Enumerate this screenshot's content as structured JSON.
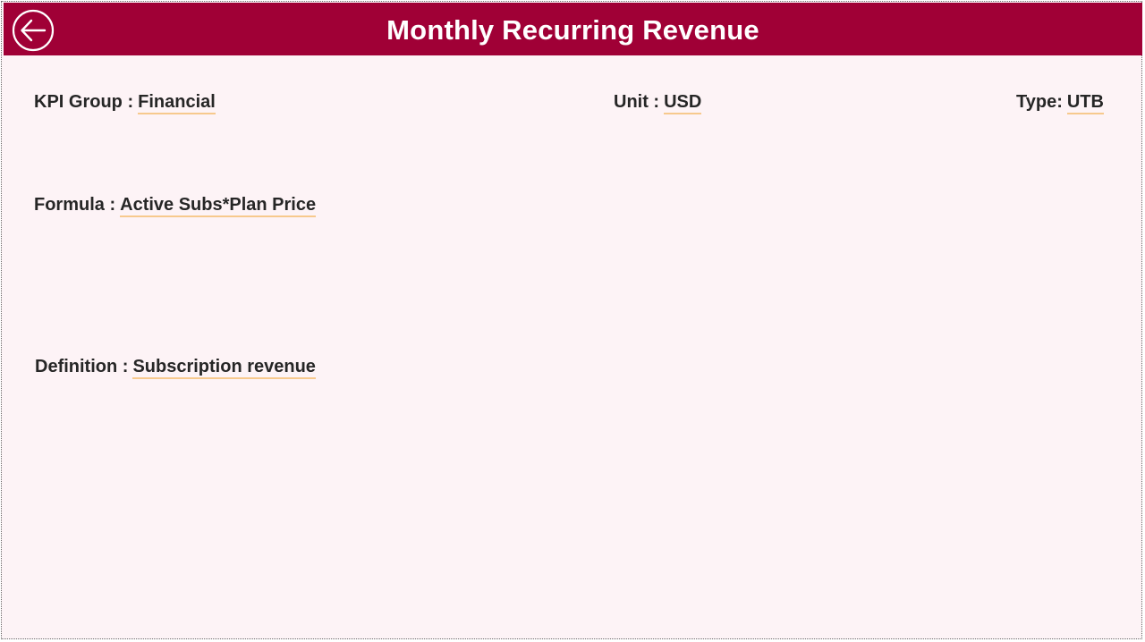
{
  "header": {
    "title": "Monthly Recurring Revenue",
    "back_icon": "back-arrow-circle-icon",
    "background_color": "#a00036"
  },
  "fields": {
    "kpi_group": {
      "label": "KPI Group :",
      "value": "Financial"
    },
    "unit": {
      "label": "Unit :",
      "value": "USD"
    },
    "type": {
      "label": "Type:",
      "value": "UTB"
    },
    "formula": {
      "label": "Formula :",
      "value": "Active Subs*Plan Price"
    },
    "definition": {
      "label": "Definition :",
      "value": "Subscription revenue"
    }
  },
  "colors": {
    "page_background": "#fdf3f6",
    "value_underline": "#f7c98d",
    "text": "#262626"
  }
}
